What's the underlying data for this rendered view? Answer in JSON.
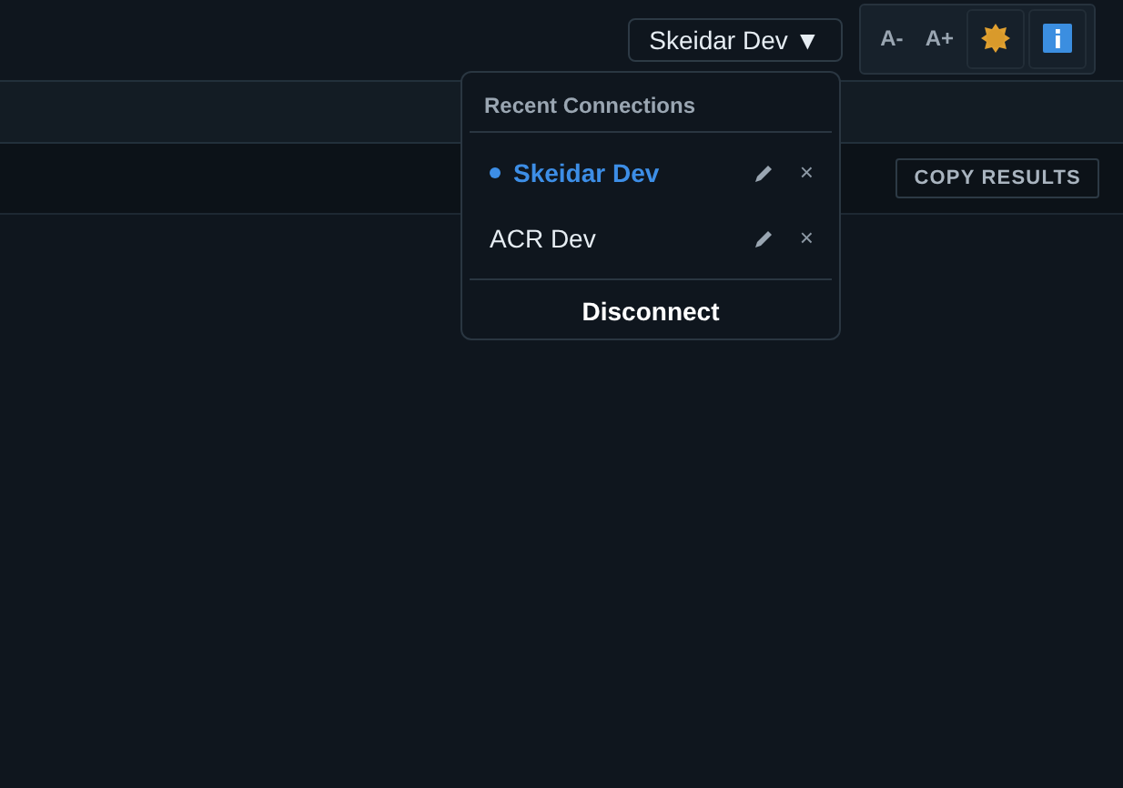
{
  "connection_button": {
    "label": "Skeidar Dev",
    "caret": "▼"
  },
  "toolbar": {
    "font_smaller": "A-",
    "font_larger": "A+"
  },
  "results_bar": {
    "copy_button": "COPY RESULTS"
  },
  "menu": {
    "heading": "Recent Connections",
    "items": [
      {
        "label": "Skeidar Dev",
        "selected": true,
        "remove": "×"
      },
      {
        "label": "ACR Dev",
        "selected": false,
        "remove": "×"
      }
    ],
    "footer": "Disconnect"
  }
}
